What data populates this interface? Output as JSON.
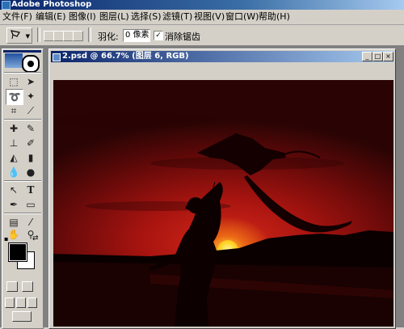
{
  "app": {
    "title": "Adobe Photoshop"
  },
  "menu": [
    "文件(F)",
    "编辑(E)",
    "图像(I)",
    "图层(L)",
    "选择(S)",
    "滤镜(T)",
    "视图(V)",
    "窗口(W)",
    "帮助(H)"
  ],
  "options": {
    "feather_label": "羽化:",
    "feather_value": "0 像素",
    "antialias_checked": true,
    "antialias_label": "消除锯齿"
  },
  "document": {
    "title": "2.psd @ 66.7% (图层 6, RGB)"
  },
  "toolbox": {
    "tools": [
      "marquee-icon",
      "move-icon",
      "lasso-icon",
      "magic-wand-icon",
      "crop-icon",
      "slice-icon",
      "healing-brush-icon",
      "brush-icon",
      "clone-stamp-icon",
      "history-brush-icon",
      "eraser-icon",
      "gradient-icon",
      "blur-icon",
      "dodge-icon",
      "path-select-icon",
      "type-icon",
      "pen-icon",
      "shape-icon",
      "notes-icon",
      "eyedropper-icon",
      "hand-icon",
      "zoom-icon"
    ],
    "foreground_color": "#000000",
    "background_color": "#ffffff"
  },
  "colors": {
    "accent": "#0a246a",
    "window": "#d4d0c8"
  }
}
